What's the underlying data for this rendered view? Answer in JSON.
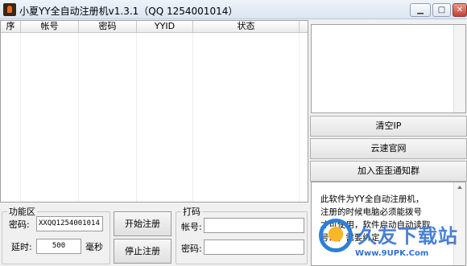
{
  "window": {
    "title": "小夏YY全自动注册机v1.3.1（QQ 1254001014）"
  },
  "table": {
    "columns": [
      "序",
      "帐号",
      "密码",
      "YYID",
      "状态"
    ]
  },
  "side_buttons": {
    "clear_ip": "清空IP",
    "cloud_site": "云速官网",
    "join_group": "加入歪歪通知群"
  },
  "notice": {
    "lines": [
      "此软件为YY全自动注册机，",
      "注册的时候电脑必须能拨号",
      "才可使用，软件启动自动读取",
      "号码，需要绑定"
    ]
  },
  "func_area": {
    "legend": "功能区",
    "password_label": "密码:",
    "password_value": "XXQQ1254001014",
    "delay_label": "延时:",
    "delay_value": "500",
    "delay_unit": "毫秒"
  },
  "actions": {
    "start": "开始注册",
    "stop": "停止注册"
  },
  "captcha": {
    "legend": "打码",
    "account_label": "帐号:",
    "password_label": "密码:"
  },
  "watermark": {
    "name": "久友下载站",
    "url": "Www.9UPK.Com"
  }
}
